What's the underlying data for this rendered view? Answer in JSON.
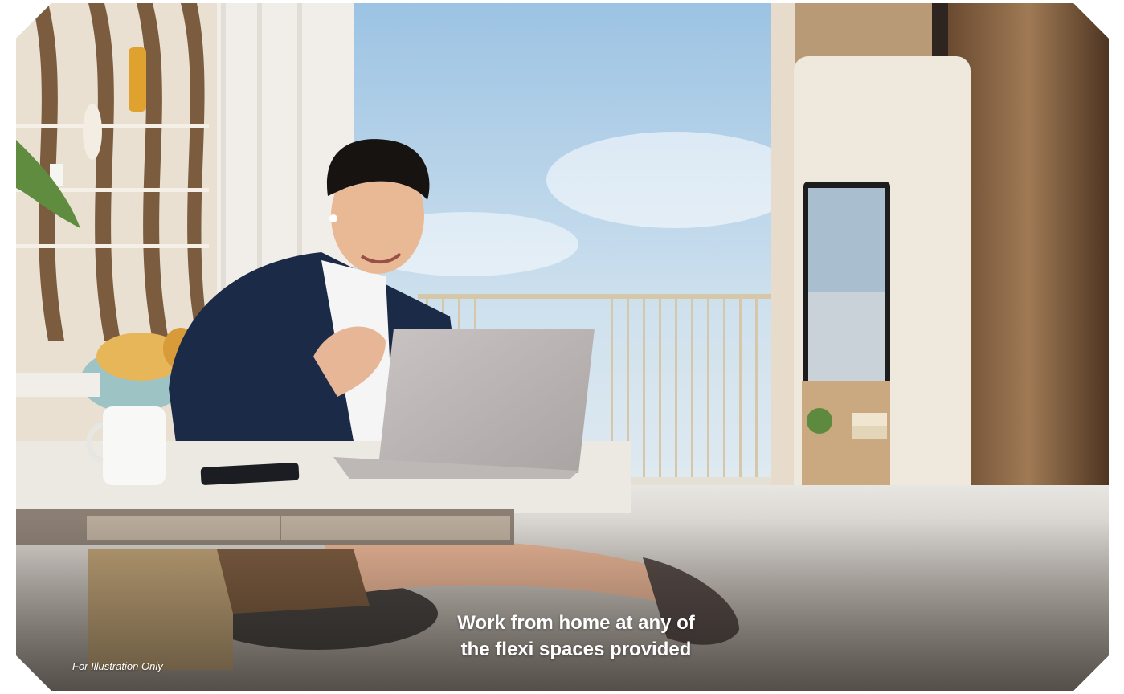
{
  "caption": {
    "line1": "Work from home at any of",
    "line2": "the flexi spaces provided"
  },
  "disclaimer": "For Illustration Only"
}
